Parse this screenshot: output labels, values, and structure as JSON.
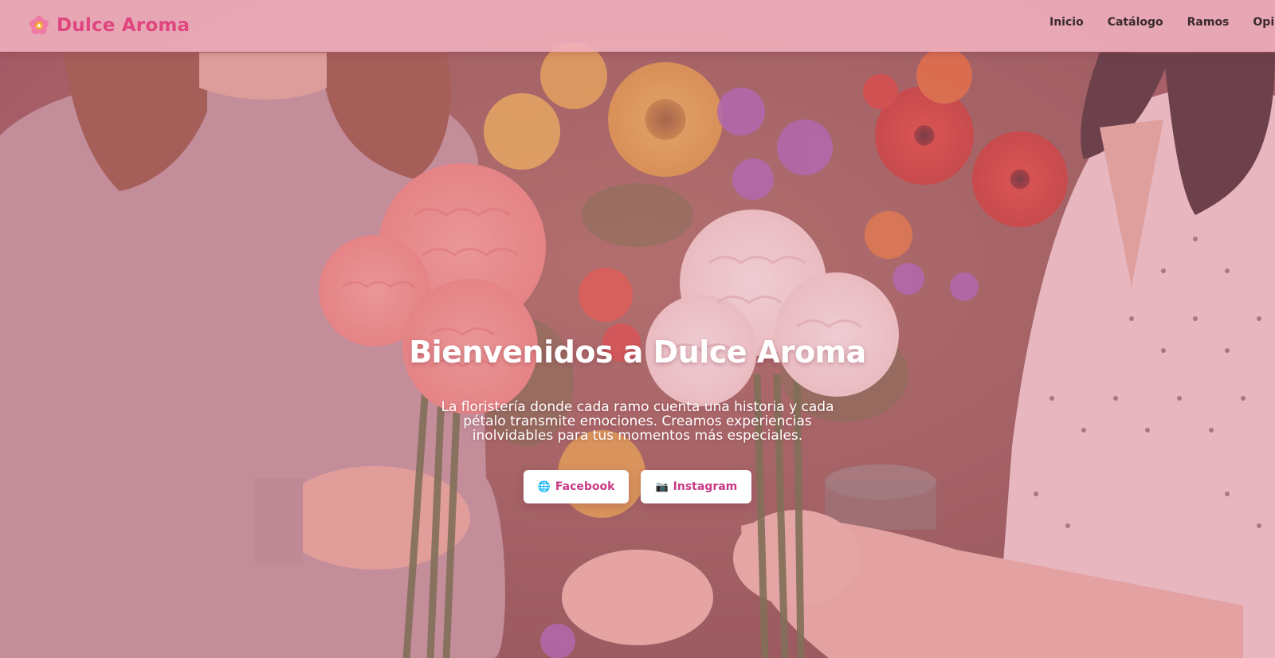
{
  "navbar": {
    "brand": {
      "icon": "flower-icon",
      "name": "Dulce Aroma"
    },
    "links": [
      {
        "label": "Inicio"
      },
      {
        "label": "Catálogo"
      },
      {
        "label": "Ramos"
      },
      {
        "label": "Opinio"
      }
    ]
  },
  "hero": {
    "title": "Bienvenidos a Dulce Aroma",
    "subtitle": "La floristería donde cada ramo cuenta una historia y cada pétalo transmite emociones. Creamos experiencias inolvidables para tus momentos más especiales.",
    "buttons": [
      {
        "icon": "globe-icon",
        "glyph": "🌐",
        "label": "Facebook"
      },
      {
        "icon": "camera-icon",
        "glyph": "📷",
        "label": "Instagram"
      }
    ],
    "background_image": "photo of two people exchanging bouquets of carnations in a flower shop"
  },
  "colors": {
    "brand": "#e0457f",
    "navbar_bg": "#f0b0be",
    "overlay": "#d6788c",
    "button_text": "#c93a86",
    "nav_text": "#3a2a30"
  }
}
